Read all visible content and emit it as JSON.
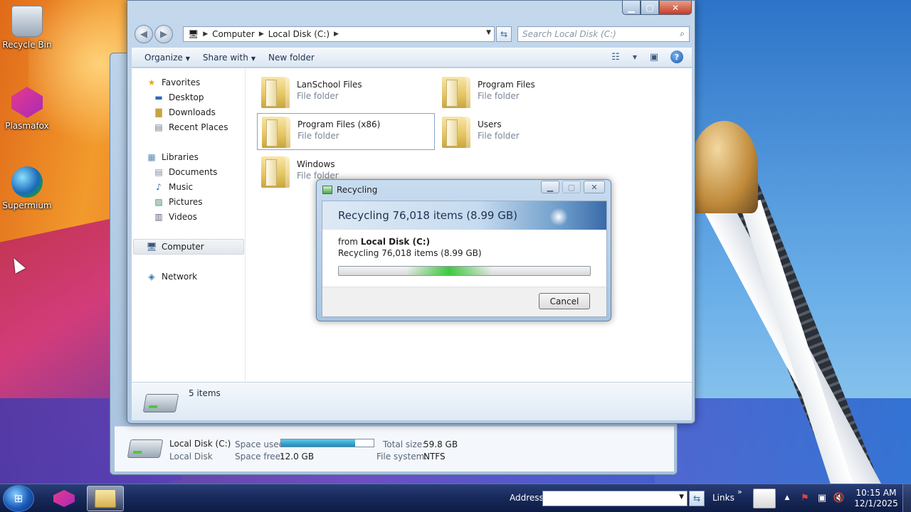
{
  "desktop": {
    "icons": [
      {
        "label": "Recycle Bin",
        "icon": "recycle-bin-icon"
      },
      {
        "label": "Plasmafox",
        "icon": "plasmafox-icon"
      },
      {
        "label": "Supermium",
        "icon": "supermium-icon"
      }
    ]
  },
  "explorer": {
    "breadcrumb": [
      "Computer",
      "Local Disk (C:)"
    ],
    "search_placeholder": "Search Local Disk (C:)",
    "toolbar": {
      "organize": "Organize",
      "share_with": "Share with",
      "new_folder": "New folder"
    },
    "nav": {
      "favorites": "Favorites",
      "desktop": "Desktop",
      "downloads": "Downloads",
      "recent_places": "Recent Places",
      "libraries": "Libraries",
      "documents": "Documents",
      "music": "Music",
      "pictures": "Pictures",
      "videos": "Videos",
      "computer": "Computer",
      "network": "Network"
    },
    "files": [
      {
        "name": "LanSchool Files",
        "type": "File folder"
      },
      {
        "name": "Program Files",
        "type": "File folder"
      },
      {
        "name": "Program Files (x86)",
        "type": "File folder"
      },
      {
        "name": "Users",
        "type": "File folder"
      },
      {
        "name": "Windows",
        "type": "File folder"
      }
    ],
    "status": {
      "items": "5 items"
    }
  },
  "back_window": {
    "drive_name": "Local Disk (C:)",
    "drive_type": "Local Disk",
    "space_used_label": "Space used:",
    "space_used_fraction": 0.8,
    "space_free_label": "Space free:",
    "space_free_value": "12.0 GB",
    "total_size_label": "Total size:",
    "total_size_value": "59.8 GB",
    "file_system_label": "File system:",
    "file_system_value": "NTFS"
  },
  "dialog": {
    "title": "Recycling",
    "banner": "Recycling 76,018 items (8.99 GB)",
    "from_prefix": "from ",
    "from_location": "Local Disk (C:)",
    "detail": "Recycling 76,018 items (8.99 GB)",
    "cancel": "Cancel"
  },
  "taskbar": {
    "address_label": "Address",
    "links_label": "Links",
    "time": "10:15 AM",
    "date": "12/1/2025"
  }
}
